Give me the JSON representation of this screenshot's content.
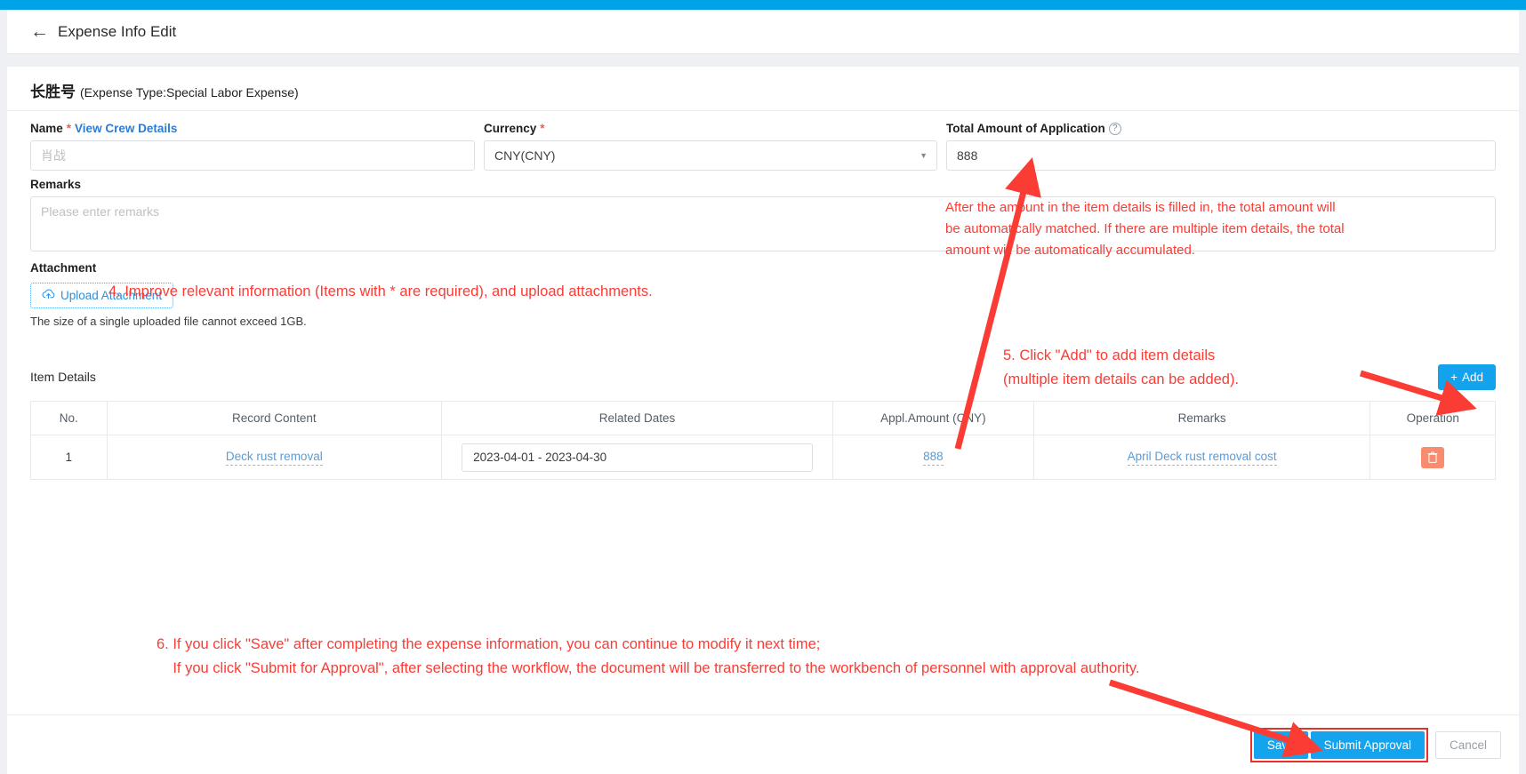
{
  "header": {
    "back_icon": "left-arrow-icon",
    "title": "Expense Info Edit"
  },
  "vessel": {
    "name": "长胜号",
    "expense_type_text": "(Expense Type:Special Labor Expense)"
  },
  "form": {
    "name_field": {
      "label": "Name",
      "required_mark": "*",
      "link_label": "View Crew Details",
      "value": "肖战"
    },
    "currency_field": {
      "label": "Currency",
      "required_mark": "*",
      "value": "CNY(CNY)",
      "caret_icon": "chevron-down-icon"
    },
    "total_amount_field": {
      "label": "Total Amount of Application",
      "help_icon": "question-mark-icon",
      "help_glyph": "?",
      "value": "888"
    },
    "remarks_field": {
      "label": "Remarks",
      "placeholder": "Please enter remarks",
      "value": ""
    },
    "attachment": {
      "label": "Attachment",
      "upload_button_label": "Upload Attachment",
      "upload_icon": "cloud-upload-icon",
      "upload_glyph": "☁",
      "hint": "The size of a single uploaded file cannot exceed 1GB."
    }
  },
  "item_details": {
    "title": "Item Details",
    "add_button_label": "Add",
    "add_icon_glyph": "+",
    "columns": [
      "No.",
      "Record Content",
      "Related Dates",
      "Appl.Amount (CNY)",
      "Remarks",
      "Operation"
    ],
    "rows": [
      {
        "no": "1",
        "record_content": "Deck rust removal",
        "related_dates": "2023-04-01 - 2023-04-30",
        "appl_amount": "888",
        "remarks": "April Deck rust removal cost",
        "delete_icon": "trash-icon",
        "delete_glyph": "🗑"
      }
    ]
  },
  "footer": {
    "save_label": "Save",
    "submit_label": "Submit Approval",
    "cancel_label": "Cancel"
  },
  "annotations": {
    "step4": "4. Improve relevant information (Items with * are required), and upload attachments.",
    "total_amount_note": "After the amount in the item details is filled in, the total amount will\nbe automatically matched. If there are multiple item details, the total\namount will be automatically accumulated.",
    "step5": "5. Click \"Add\" to add item details\n(multiple item details can be added).",
    "step6": "6. If you click \"Save\" after completing the expense information, you can continue to modify it next time;\n    If you click \"Submit for Approval\", after selecting the workflow, the document will be transferred to the workbench of personnel with approval authority."
  },
  "colors": {
    "top_bar": "#00a2e8",
    "primary": "#13a3ec",
    "annotation_red": "#fa3c35",
    "delete_button": "#f98c6e",
    "required_star": "#e8604c",
    "link_blue": "#2b7cd3"
  }
}
